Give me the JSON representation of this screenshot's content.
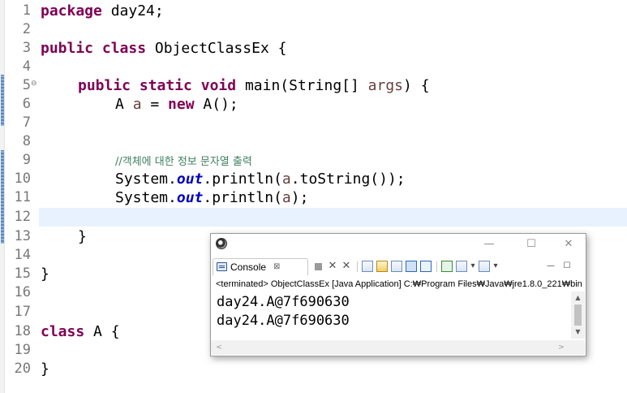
{
  "editor": {
    "line_numbers": [
      "1",
      "2",
      "3",
      "4",
      "5",
      "6",
      "7",
      "8",
      "9",
      "10",
      "11",
      "12",
      "13",
      "14",
      "15",
      "16",
      "17",
      "18",
      "19",
      "20"
    ],
    "fold_marker": "⊖",
    "lines": {
      "l1_kw": "package",
      "l1_rest": " day24;",
      "l3_kw1": "public",
      "l3_kw2": "class",
      "l3_rest": " ObjectClassEx {",
      "l5_kw1": "public",
      "l5_kw2": "static",
      "l5_kw3": "void",
      "l5_mid": " main(String[] ",
      "l5_param": "args",
      "l5_end": ") {",
      "l6_a": "A ",
      "l6_var": "a",
      "l6_eq": " = ",
      "l6_kw": "new",
      "l6_end": " A();",
      "l9_comment": "//객체에 대한 정보 문자열 출력",
      "l10_a": "System.",
      "l10_out": "out",
      "l10_b": ".println(",
      "l10_var": "a",
      "l10_c": ".toString());",
      "l11_a": "System.",
      "l11_out": "out",
      "l11_b": ".println(",
      "l11_var": "a",
      "l11_c": ");",
      "l13": "}",
      "l15": "}",
      "l18_kw": "class",
      "l18_rest": " A {",
      "l20": "}"
    }
  },
  "console_window": {
    "title": "",
    "tab_label": "Console",
    "tab_close": "⊠",
    "launch_path": "<terminated> ObjectClassEx [Java Application] C:₩Program Files₩Java₩jre1.8.0_221₩bin",
    "output": [
      "day24.A@7f690630",
      "day24.A@7f690630"
    ],
    "window_controls": {
      "minimize": "—",
      "maximize": "☐",
      "close": "✕"
    }
  }
}
